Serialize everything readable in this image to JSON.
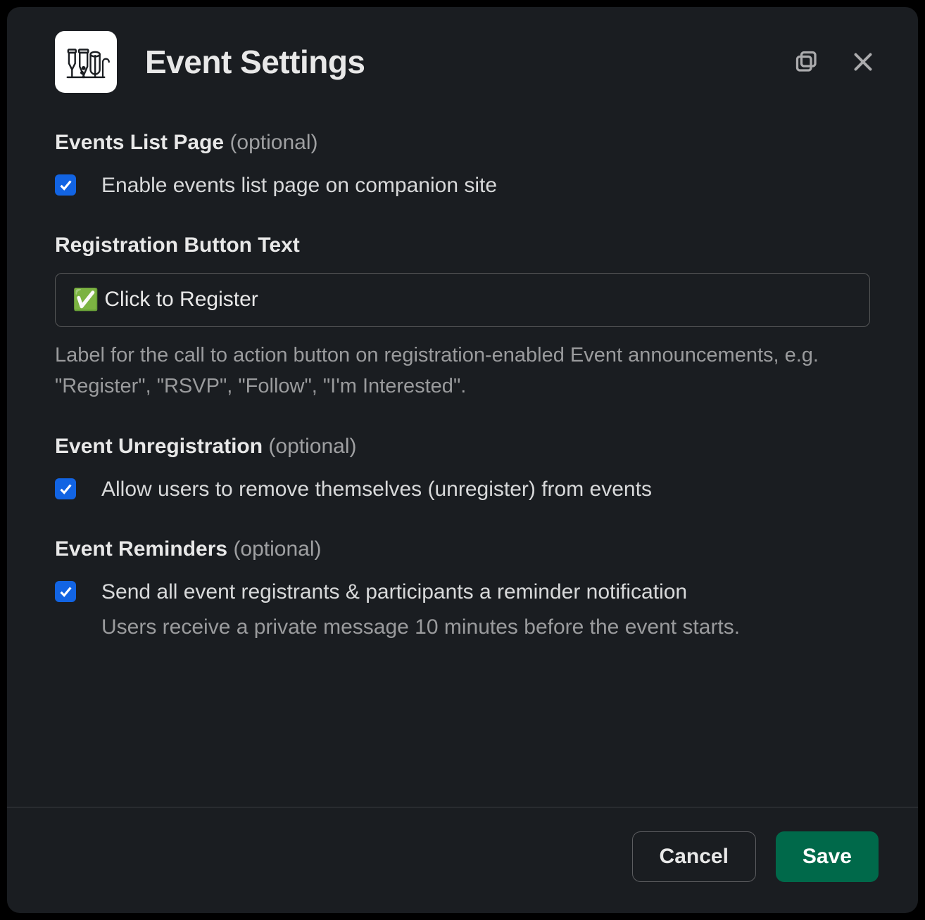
{
  "header": {
    "title": "Event Settings"
  },
  "sections": {
    "events_list": {
      "title": "Events List Page",
      "optional_tag": "(optional)",
      "checkbox_label": "Enable events list page on companion site",
      "checked": true
    },
    "reg_button": {
      "title": "Registration Button Text",
      "input_emoji": "✅",
      "input_value": "Click to Register",
      "help_text": "Label for the call to action button on registration-enabled Event announcements, e.g. \"Register\", \"RSVP\", \"Follow\", \"I'm Interested\"."
    },
    "unregistration": {
      "title": "Event Unregistration",
      "optional_tag": "(optional)",
      "checkbox_label": "Allow users to remove themselves (unregister) from events",
      "checked": true
    },
    "reminders": {
      "title": "Event Reminders",
      "optional_tag": "(optional)",
      "checkbox_label": "Send all event registrants & participants a reminder notification",
      "checkbox_sub": "Users receive a private message 10 minutes before the event starts.",
      "checked": true
    }
  },
  "footer": {
    "cancel": "Cancel",
    "save": "Save"
  }
}
